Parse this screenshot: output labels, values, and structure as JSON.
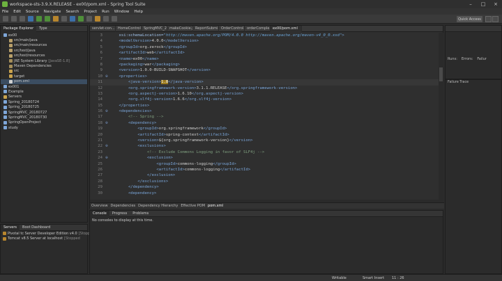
{
  "window": {
    "title": "workspace-sts-3.9.X.RELEASE - ex00/pom.xml - Spring Tool Suite"
  },
  "menu": [
    "File",
    "Edit",
    "Source",
    "Navigate",
    "Search",
    "Project",
    "Run",
    "Window",
    "Help"
  ],
  "toolbar": {
    "quick_access": "Quick Access"
  },
  "package_explorer": {
    "tabs": [
      "Package Explorer",
      "Type"
    ],
    "items": [
      {
        "label": "ex00",
        "indent": 0,
        "color": "#7ea6d8"
      },
      {
        "label": "src/main/java",
        "indent": 1,
        "color": "#b9a06a"
      },
      {
        "label": "src/main/resources",
        "indent": 1,
        "color": "#b9a06a"
      },
      {
        "label": "src/test/java",
        "indent": 1,
        "color": "#b9a06a"
      },
      {
        "label": "src/test/resources",
        "indent": 1,
        "color": "#b9a06a"
      },
      {
        "label": "JRE System Library",
        "deco": "[JavaSE-1.8]",
        "indent": 1,
        "color": "#a58e5a"
      },
      {
        "label": "Maven Dependencies",
        "indent": 1,
        "color": "#a58e5a"
      },
      {
        "label": "src",
        "indent": 1,
        "color": "#c9a34e"
      },
      {
        "label": "target",
        "indent": 1,
        "color": "#c9a34e"
      },
      {
        "label": "pom.xml",
        "indent": 1,
        "color": "#d0d0d0",
        "selected": true
      },
      {
        "label": "ex001",
        "indent": 0,
        "color": "#7ea6d8"
      },
      {
        "label": "Example",
        "indent": 0,
        "color": "#7ea6d8"
      },
      {
        "label": "Servers",
        "indent": 0,
        "color": "#c9a34e"
      },
      {
        "label": "Spring_20180724",
        "indent": 0,
        "color": "#7ea6d8"
      },
      {
        "label": "Spring_20180725",
        "indent": 0,
        "color": "#7ea6d8"
      },
      {
        "label": "SpringMVC_20180727",
        "indent": 0,
        "color": "#7ea6d8"
      },
      {
        "label": "SpringMVC_20180730",
        "indent": 0,
        "color": "#7ea6d8"
      },
      {
        "label": "SpringOpenProject",
        "indent": 0,
        "color": "#7ea6d8"
      },
      {
        "label": "study",
        "indent": 0,
        "color": "#7ea6d8"
      }
    ]
  },
  "servers": {
    "tabs": [
      "Servers",
      "Boot Dashboard"
    ],
    "items": [
      {
        "label": "Pivotal tc Server Developer Edition v4.0",
        "deco": "[Stopp"
      },
      {
        "label": "Tomcat v8.5 Server at localhost",
        "deco": "[Stopped"
      }
    ]
  },
  "editor": {
    "tabs": [
      "servlet-con...",
      "HomeControl...",
      "SpringMVC_2...",
      "makeCookie.jsp",
      "ReportSubmi...",
      "OrderControl...",
      "orderComple...",
      "ex00/pom.xml"
    ],
    "active_tab": 7,
    "lines": [
      {
        "n": "3",
        "segs": [
          [
            "a",
            "    xsi:schemaLocation="
          ],
          [
            "v",
            "\"http://maven.apache.org/POM/4.0.0 http://maven.apache.org/maven-v4_0_0.xsd\""
          ],
          [
            "t",
            ">"
          ]
        ]
      },
      {
        "n": "4",
        "segs": [
          [
            "t",
            "    <modelVersion>"
          ],
          [
            "x",
            "4.0.0"
          ],
          [
            "t",
            "</modelVersion>"
          ]
        ]
      },
      {
        "n": "5",
        "segs": [
          [
            "t",
            "    <groupId>"
          ],
          [
            "x",
            "org.zerock"
          ],
          [
            "t",
            "</groupId>"
          ]
        ]
      },
      {
        "n": "6",
        "segs": [
          [
            "t",
            "    <artifactId>"
          ],
          [
            "x",
            "web"
          ],
          [
            "t",
            "</artifactId>"
          ]
        ]
      },
      {
        "n": "7",
        "segs": [
          [
            "t",
            "    <name>"
          ],
          [
            "x",
            "ex00"
          ],
          [
            "t",
            "</name>"
          ]
        ]
      },
      {
        "n": "8",
        "segs": [
          [
            "t",
            "    <packaging>"
          ],
          [
            "x",
            "war"
          ],
          [
            "t",
            "</packaging>"
          ]
        ]
      },
      {
        "n": "9",
        "segs": [
          [
            "t",
            "    <version>"
          ],
          [
            "x",
            "1.0.0-BUILD-SNAPSHOT"
          ],
          [
            "t",
            "</version>"
          ]
        ]
      },
      {
        "n": "10",
        "fold": "⊖",
        "segs": [
          [
            "t",
            "    <properties>"
          ]
        ]
      },
      {
        "n": "11",
        "hl": true,
        "segs": [
          [
            "t",
            "        <java-version>"
          ],
          [
            "mark",
            "1.8"
          ],
          [
            "t",
            "</java-version>"
          ]
        ]
      },
      {
        "n": "12",
        "segs": [
          [
            "t",
            "        <org.springframework-version>"
          ],
          [
            "x",
            "3.1.1.RELEASE"
          ],
          [
            "t",
            "</org.springframework-version>"
          ]
        ]
      },
      {
        "n": "13",
        "segs": [
          [
            "t",
            "        <org.aspectj-version>"
          ],
          [
            "x",
            "1.6.10"
          ],
          [
            "t",
            "</org.aspectj-version>"
          ]
        ]
      },
      {
        "n": "14",
        "segs": [
          [
            "t",
            "        <org.slf4j-version>"
          ],
          [
            "x",
            "1.6.6"
          ],
          [
            "t",
            "</org.slf4j-version>"
          ]
        ]
      },
      {
        "n": "15",
        "segs": [
          [
            "t",
            "    </properties>"
          ]
        ]
      },
      {
        "n": "16",
        "fold": "⊖",
        "segs": [
          [
            "t",
            "    <dependencies>"
          ]
        ]
      },
      {
        "n": "17",
        "segs": [
          [
            "cm",
            "        <!-- Spring -->"
          ]
        ]
      },
      {
        "n": "18",
        "fold": "⊖",
        "segs": [
          [
            "t",
            "        <dependency>"
          ]
        ]
      },
      {
        "n": "19",
        "segs": [
          [
            "t",
            "            <groupId>"
          ],
          [
            "x",
            "org.springframework"
          ],
          [
            "t",
            "</groupId>"
          ]
        ]
      },
      {
        "n": "20",
        "segs": [
          [
            "t",
            "            <artifactId>"
          ],
          [
            "x",
            "spring-context"
          ],
          [
            "t",
            "</artifactId>"
          ]
        ]
      },
      {
        "n": "21",
        "segs": [
          [
            "t",
            "            <version>"
          ],
          [
            "x",
            "${org.springframework-version}"
          ],
          [
            "t",
            "</version>"
          ]
        ]
      },
      {
        "n": "22",
        "fold": "⊖",
        "segs": [
          [
            "t",
            "            <exclusions>"
          ]
        ]
      },
      {
        "n": "23",
        "segs": [
          [
            "cm",
            "                <!-- Exclude Commons Logging in favor of SLF4j -->"
          ]
        ]
      },
      {
        "n": "24",
        "fold": "⊖",
        "segs": [
          [
            "t",
            "                <exclusion>"
          ]
        ]
      },
      {
        "n": "25",
        "segs": [
          [
            "t",
            "                    <groupId>"
          ],
          [
            "x",
            "commons-logging"
          ],
          [
            "t",
            "</groupId>"
          ]
        ]
      },
      {
        "n": "26",
        "segs": [
          [
            "t",
            "                    <artifactId>"
          ],
          [
            "x",
            "commons-logging"
          ],
          [
            "t",
            "</artifactId>"
          ]
        ]
      },
      {
        "n": "27",
        "segs": [
          [
            "t",
            "                </exclusion>"
          ]
        ]
      },
      {
        "n": "28",
        "segs": [
          [
            "t",
            "            </exclusions>"
          ]
        ]
      },
      {
        "n": "29",
        "segs": [
          [
            "t",
            "        </dependency>"
          ]
        ]
      },
      {
        "n": "30",
        "segs": [
          [
            "t",
            "        <dependency>"
          ]
        ]
      }
    ],
    "bottom_tabs": [
      "Overview",
      "Dependencies",
      "Dependency Hierarchy",
      "Effective POM",
      "pom.xml"
    ],
    "active_bottom_tab": 4
  },
  "console": {
    "tabs": [
      "Console",
      "Progress",
      "Problems"
    ],
    "message": "No consoles to display at this time."
  },
  "right_panel": {
    "labels": [
      "Runs:",
      "Errors:",
      "Failur"
    ]
  },
  "junit": {
    "title": "Failure Trace"
  },
  "statusbar": {
    "writable": "Writable",
    "insert_mode": "Smart Insert",
    "position": "11 : 26"
  }
}
